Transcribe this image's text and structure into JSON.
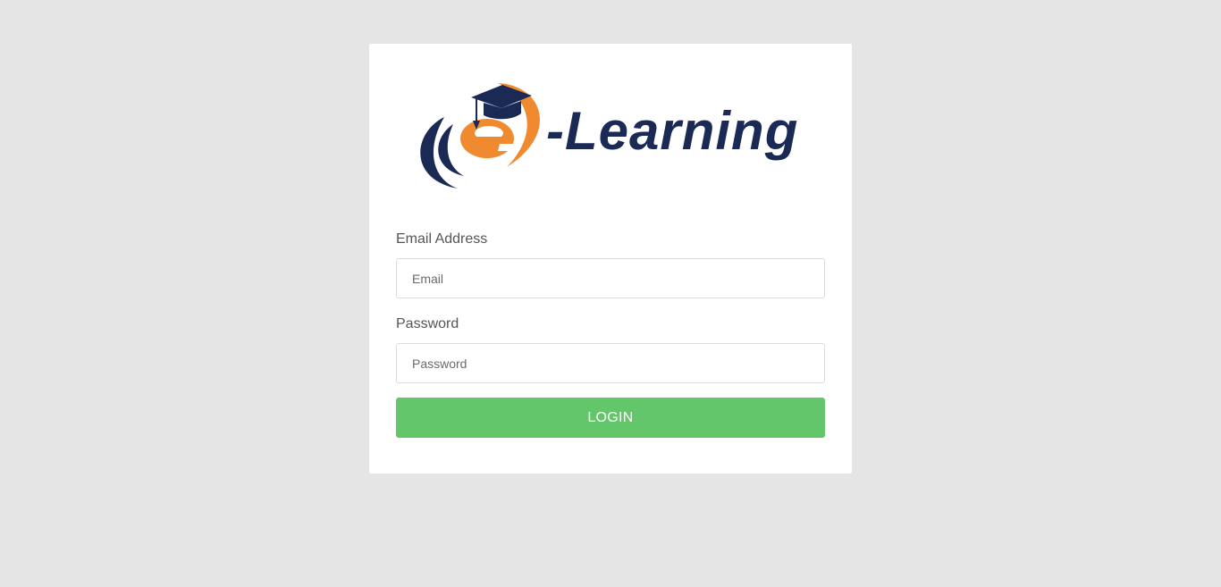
{
  "logo": {
    "letter": "e",
    "word": "-Learning",
    "icon": "graduation-cap-icon",
    "colors": {
      "navy": "#1b2a55",
      "orange": "#f08a30"
    }
  },
  "form": {
    "email": {
      "label": "Email Address",
      "placeholder": "Email",
      "value": ""
    },
    "password": {
      "label": "Password",
      "placeholder": "Password",
      "value": ""
    },
    "submit_label": "LOGIN"
  },
  "colors": {
    "background": "#e5e5e5",
    "card": "#ffffff",
    "button": "#64c66b"
  }
}
